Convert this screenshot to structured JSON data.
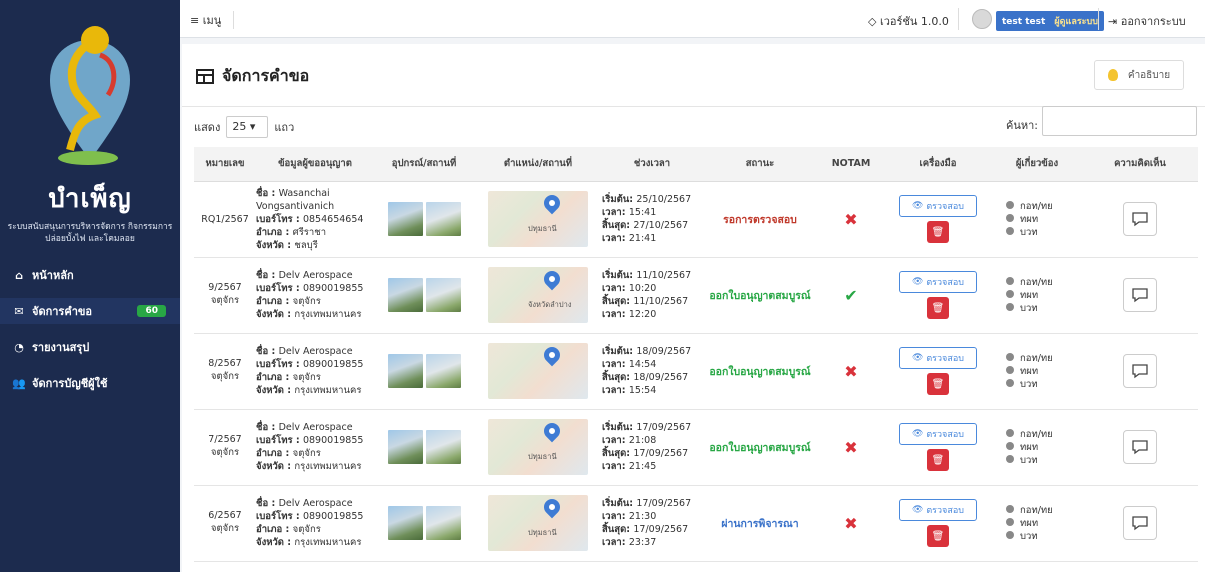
{
  "sidebar": {
    "brand": "บำเพ็ญ",
    "subtitle": "ระบบสนับสนุนการบริหารจัดการ กิจกรรมการปล่อยบั้งไฟ และโคมลอย",
    "items": [
      {
        "label": "หน้าหลัก",
        "icon": "home-icon"
      },
      {
        "label": "จัดการคำขอ",
        "icon": "envelope-icon",
        "badge": "60"
      },
      {
        "label": "รายงานสรุป",
        "icon": "chart-pie-icon"
      },
      {
        "label": "จัดการบัญชีผู้ใช้",
        "icon": "users-icon"
      }
    ]
  },
  "topbar": {
    "menu_label": "≡ เมนู",
    "version": "เวอร์ชัน 1.0.0",
    "user_name": "test test",
    "user_role": "ผู้ดูแลระบบ",
    "logout": "ออกจากระบบ"
  },
  "page": {
    "title": "จัดการคำขอ",
    "help_label": "คำอธิบาย",
    "show_label": "แสดง",
    "page_size": "25",
    "rows_label": "แถว",
    "search_label": "ค้นหา:"
  },
  "table": {
    "headers": [
      "หมายเลข",
      "ข้อมูลผู้ขออนุญาต",
      "อุปกรณ์/สถานที่",
      "ตำแหน่ง/สถานที่",
      "ช่วงเวลา",
      "สถานะ",
      "NOTAM",
      "เครื่องมือ",
      "ผู้เกี่ยวข้อง",
      "ความคิดเห็น"
    ],
    "labels": {
      "name": "ชื่อ : ",
      "phone": "เบอร์โทร : ",
      "district": "อำเภอ : ",
      "province": "จังหวัด : ",
      "start_date": "เริ่มต้น: ",
      "time": "เวลา: ",
      "end_date": "สิ้นสุด: ",
      "tool": "ตรวจสอบ",
      "related": [
        "กอท/ทย",
        "ทผท",
        "บวท"
      ]
    },
    "rows": [
      {
        "number": "RQ1/2567",
        "number_sub": "",
        "name": "Wasanchai Vongsantivanich",
        "phone": "0854654654",
        "district": "ศรีราชา",
        "province": "ชลบุรี",
        "map_label": "ปทุมธานี",
        "start_date": "25/10/2567",
        "start_time": "15:41",
        "end_date": "27/10/2567",
        "end_time": "21:41",
        "status": "รอการตรวจสอบ",
        "status_color": "#c0392b",
        "notam": "no"
      },
      {
        "number": "9/2567",
        "number_sub": "จตุจักร",
        "name": "Delv Aerospace",
        "phone": "0890019855",
        "district": "จตุจักร",
        "province": "กรุงเทพมหานคร",
        "map_label": "จังหวัดลำปาง",
        "start_date": "11/10/2567",
        "start_time": "10:20",
        "end_date": "11/10/2567",
        "end_time": "12:20",
        "status": "ออกใบอนุญาตสมบูรณ์",
        "status_color": "#28a745",
        "notam": "yes"
      },
      {
        "number": "8/2567",
        "number_sub": "จตุจักร",
        "name": "Delv Aerospace",
        "phone": "0890019855",
        "district": "จตุจักร",
        "province": "กรุงเทพมหานคร",
        "map_label": "",
        "start_date": "18/09/2567",
        "start_time": "14:54",
        "end_date": "18/09/2567",
        "end_time": "15:54",
        "status": "ออกใบอนุญาตสมบูรณ์",
        "status_color": "#28a745",
        "notam": "no"
      },
      {
        "number": "7/2567",
        "number_sub": "จตุจักร",
        "name": "Delv Aerospace",
        "phone": "0890019855",
        "district": "จตุจักร",
        "province": "กรุงเทพมหานคร",
        "map_label": "ปทุมธานี",
        "start_date": "17/09/2567",
        "start_time": "21:08",
        "end_date": "17/09/2567",
        "end_time": "21:45",
        "status": "ออกใบอนุญาตสมบูรณ์",
        "status_color": "#28a745",
        "notam": "no"
      },
      {
        "number": "6/2567",
        "number_sub": "จตุจักร",
        "name": "Delv Aerospace",
        "phone": "0890019855",
        "district": "จตุจักร",
        "province": "กรุงเทพมหานคร",
        "map_label": "ปทุมธานี",
        "start_date": "17/09/2567",
        "start_time": "21:30",
        "end_date": "17/09/2567",
        "end_time": "23:37",
        "status": "ผ่านการพิจารณา",
        "status_color": "#3a72c9",
        "notam": "no"
      }
    ]
  }
}
